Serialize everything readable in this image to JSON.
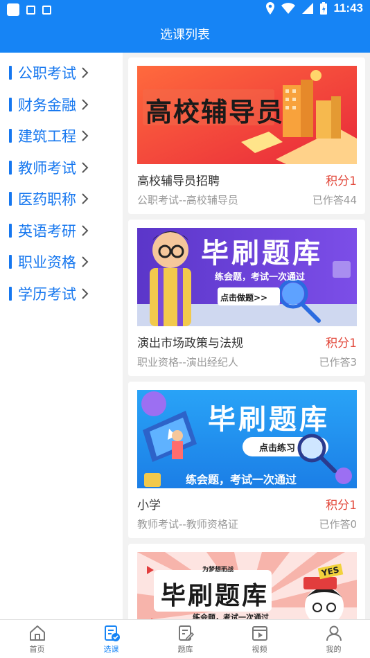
{
  "status_bar": {
    "time": "11:43"
  },
  "header": {
    "title": "选课列表"
  },
  "sidebar": {
    "items": [
      {
        "label": "公职考试"
      },
      {
        "label": "财务金融"
      },
      {
        "label": "建筑工程"
      },
      {
        "label": "教师考试"
      },
      {
        "label": "医药职称"
      },
      {
        "label": "英语考研"
      },
      {
        "label": "职业资格"
      },
      {
        "label": "学历考试"
      }
    ]
  },
  "courses": [
    {
      "banner_text": "高校辅导员",
      "name": "高校辅导员招聘",
      "points": "积分1",
      "category": "公职考试--高校辅导员",
      "answered": "已作答44"
    },
    {
      "banner_text": "毕刷题库",
      "banner_sub": "练会题，考试一次通过",
      "banner_button": "点击做题>>",
      "name": "演出市场政策与法规",
      "points": "积分1",
      "category": "职业资格--演出经纪人",
      "answered": "已作答3"
    },
    {
      "banner_text": "毕刷题库",
      "banner_sub": "练会题，考试一次通过",
      "banner_button": "点击练习",
      "name": "小学",
      "points": "积分1",
      "category": "教师考试--教师资格证",
      "answered": "已作答0"
    },
    {
      "banner_text": "毕刷题库",
      "banner_sub": "练会题，考试一次通过",
      "banner_tag": "为梦想而战",
      "banner_badge": "YES",
      "name": "",
      "points": "",
      "category": "",
      "answered": ""
    }
  ],
  "tabbar": {
    "tabs": [
      {
        "label": "首页"
      },
      {
        "label": "选课"
      },
      {
        "label": "题库"
      },
      {
        "label": "视频"
      },
      {
        "label": "我的"
      }
    ],
    "active_color": "#1684f5"
  },
  "colors": {
    "brand": "#1684f5",
    "points": "#e2483b"
  }
}
